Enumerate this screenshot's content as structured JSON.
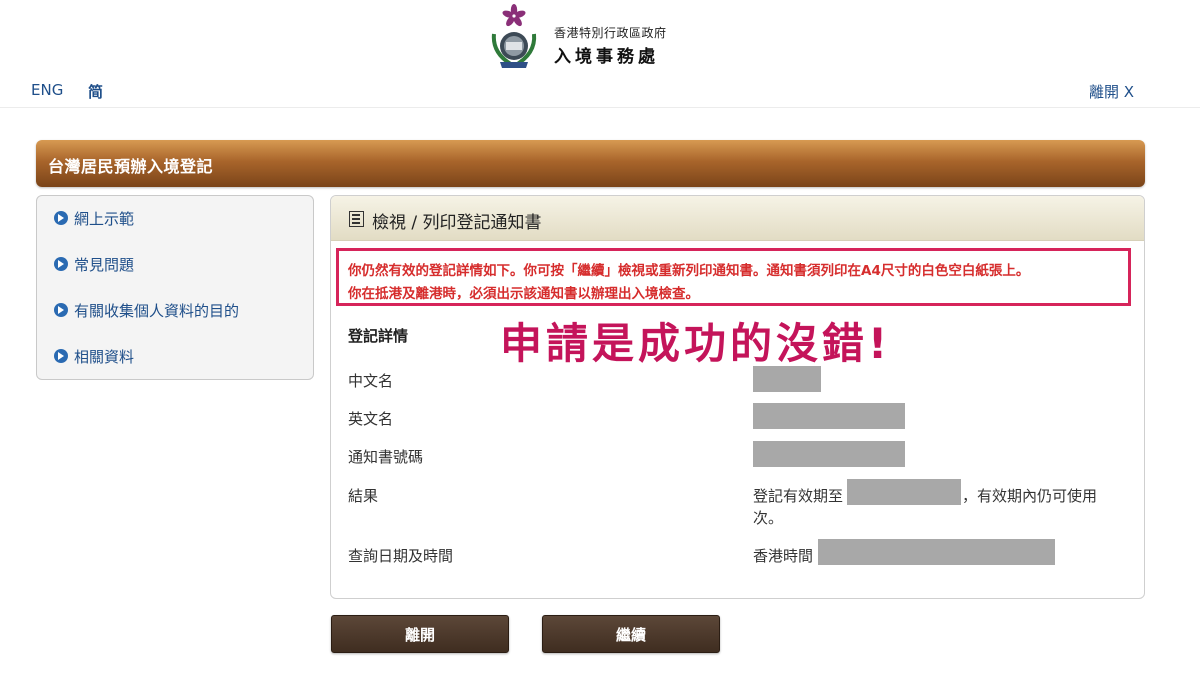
{
  "header": {
    "dept_name_small": "香港特別行政區政府",
    "dept_name_big": "入境事務處",
    "lang_eng": "ENG",
    "lang_sc": "简",
    "leave_link": "離開 X"
  },
  "title_bar": "台灣居民預辦入境登記",
  "sidebar": {
    "items": [
      {
        "label": "網上示範"
      },
      {
        "label": "常見問題"
      },
      {
        "label": "有關收集個人資料的目的"
      },
      {
        "label": "相關資料"
      }
    ]
  },
  "panel": {
    "title": "檢視 / 列印登記通知書",
    "notice_line1": "你仍然有效的登記詳情如下。你可按「繼續」檢視或重新列印通知書。通知書須列印在A4尺寸的白色空白紙張上。",
    "notice_line2": "你在抵港及離港時，必須出示該通知書以辦理出入境檢查。",
    "overlay_text": "申請是成功的沒錯!",
    "section_title": "登記詳情",
    "rows": [
      {
        "label": "中文名"
      },
      {
        "label": "英文名"
      },
      {
        "label": "通知書號碼"
      },
      {
        "label": "結果",
        "value_prefix": "登記有效期至",
        "value_suffix": "，有效期內仍可使用",
        "value_line2": "次。"
      },
      {
        "label": "查詢日期及時間",
        "value_prefix": "香港時間"
      }
    ]
  },
  "buttons": {
    "leave": "離開",
    "continue": "繼續"
  },
  "colors": {
    "title_bar": "#a9652b",
    "notice_border": "#d6245a",
    "notice_text": "#d62d2d",
    "overlay_text": "#c4145a",
    "button": "#4a3628",
    "link": "#1f4f8a"
  }
}
